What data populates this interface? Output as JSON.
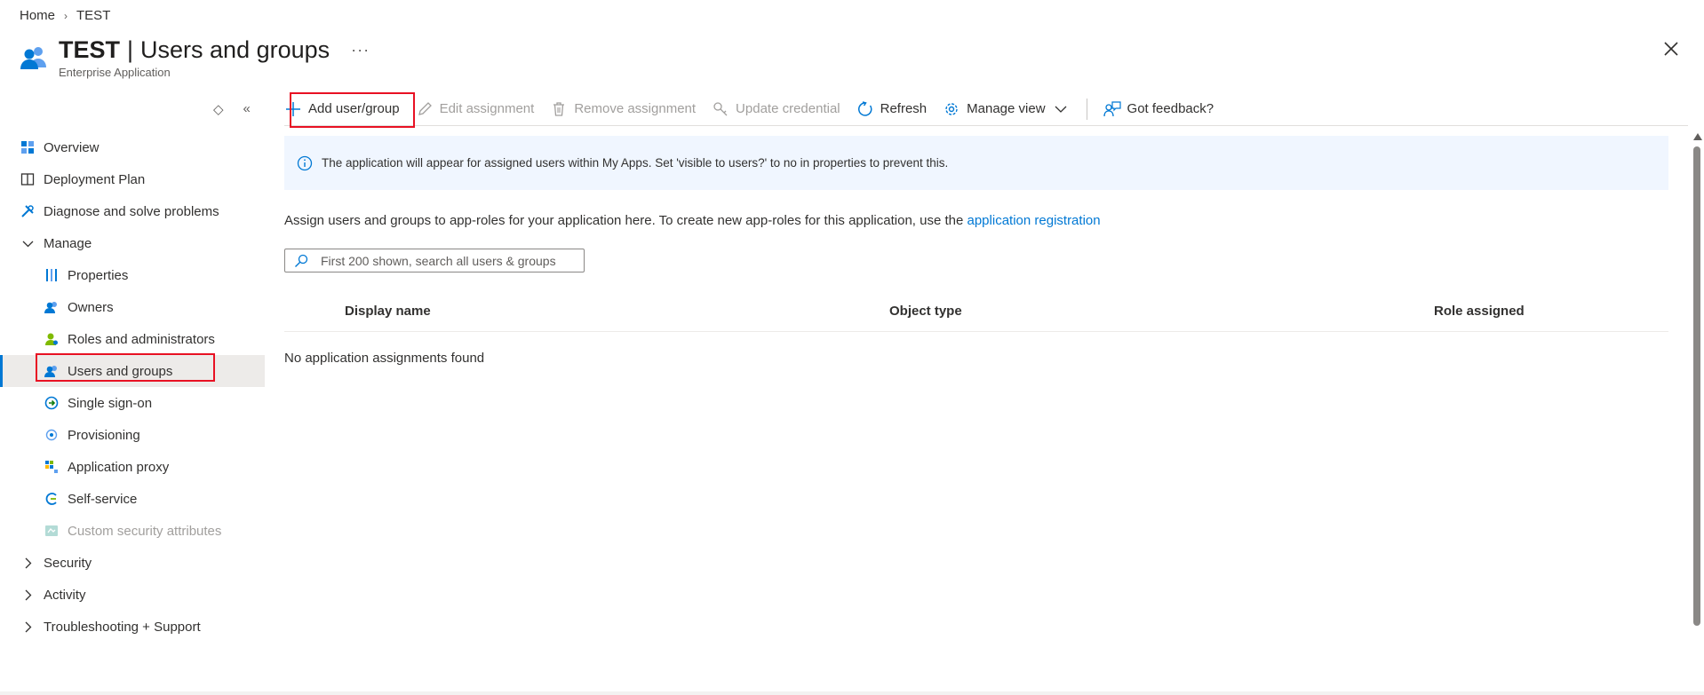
{
  "breadcrumb": {
    "home": "Home",
    "current": "TEST"
  },
  "header": {
    "title_bold": "TEST",
    "title_sep": "|",
    "title_rest": "Users and groups",
    "more": "···",
    "subtitle": "Enterprise Application"
  },
  "sidebar": {
    "tools": {
      "expand": "◇",
      "collapse": "«"
    },
    "items": [
      {
        "label": "Overview",
        "icon": "overview-grid-icon"
      },
      {
        "label": "Deployment Plan",
        "icon": "book-icon"
      },
      {
        "label": "Diagnose and solve problems",
        "icon": "wrench-icon"
      },
      {
        "label": "Manage",
        "icon": "chevron-down-icon"
      },
      {
        "label": "Properties",
        "icon": "properties-icon"
      },
      {
        "label": "Owners",
        "icon": "owners-icon"
      },
      {
        "label": "Roles and administrators",
        "icon": "roles-icon"
      },
      {
        "label": "Users and groups",
        "icon": "users-groups-icon"
      },
      {
        "label": "Single sign-on",
        "icon": "sso-icon"
      },
      {
        "label": "Provisioning",
        "icon": "provisioning-icon"
      },
      {
        "label": "Application proxy",
        "icon": "app-proxy-icon"
      },
      {
        "label": "Self-service",
        "icon": "self-service-icon"
      },
      {
        "label": "Custom security attributes",
        "icon": "custom-attributes-icon"
      },
      {
        "label": "Security",
        "icon": "chevron-right-icon"
      },
      {
        "label": "Activity",
        "icon": "chevron-right-icon"
      },
      {
        "label": "Troubleshooting + Support",
        "icon": "chevron-right-icon"
      }
    ]
  },
  "toolbar": {
    "add": "Add user/group",
    "edit": "Edit assignment",
    "remove": "Remove assignment",
    "update": "Update credential",
    "refresh": "Refresh",
    "manage_view": "Manage view",
    "feedback": "Got feedback?"
  },
  "info_banner": "The application will appear for assigned users within My Apps. Set 'visible to users?' to no in properties to prevent this.",
  "description": {
    "text": "Assign users and groups to app-roles for your application here. To create new app-roles for this application, use the ",
    "link": "application registration"
  },
  "search": {
    "placeholder": "First 200 shown, search all users & groups"
  },
  "table": {
    "columns": [
      "Display name",
      "Object type",
      "Role assigned"
    ],
    "empty_message": "No application assignments found"
  },
  "colors": {
    "accent": "#0078d4",
    "highlight_box": "#e81123",
    "banner_bg": "#f0f6ff"
  }
}
